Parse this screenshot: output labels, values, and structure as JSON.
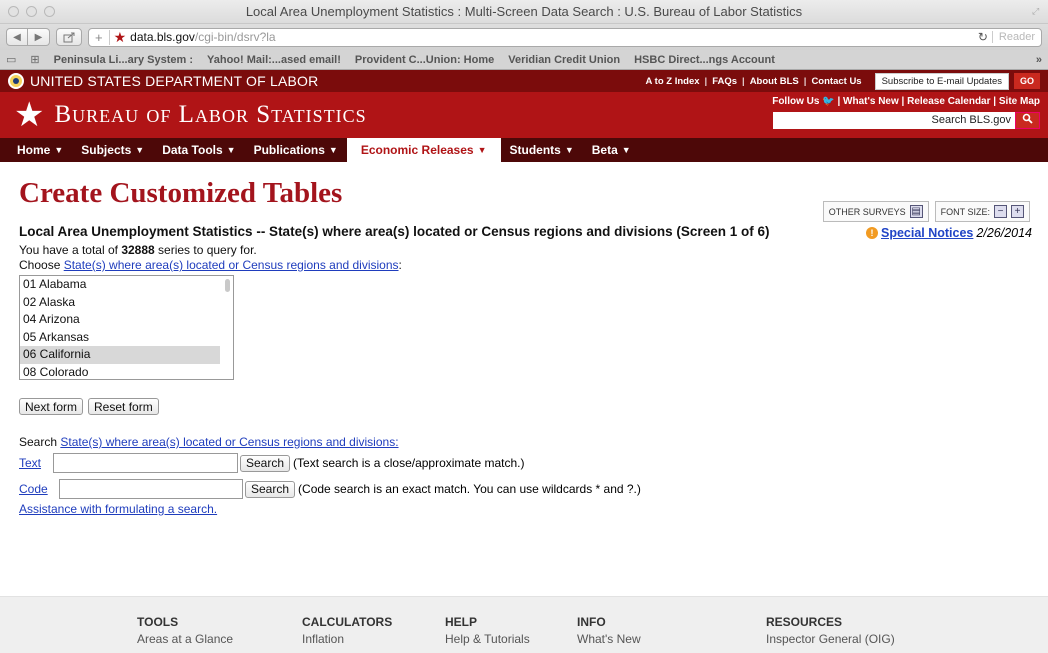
{
  "browser": {
    "window_title": "Local Area Unemployment Statistics : Multi-Screen Data Search : U.S. Bureau of Labor Statistics",
    "url_host": "data.bls.gov",
    "url_path": "/cgi-bin/dsrv?la",
    "reader_label": "Reader",
    "bookmarks": [
      "Peninsula Li...ary System :",
      "Yahoo! Mail:...ased email!",
      "Provident C...Union: Home",
      "Veridian Credit Union",
      "HSBC Direct...ngs Account"
    ],
    "overflow_glyph": "»"
  },
  "dol": {
    "name": "UNITED STATES DEPARTMENT OF LABOR",
    "links": [
      "A to Z Index",
      "FAQs",
      "About BLS",
      "Contact Us"
    ],
    "subscribe": "Subscribe to E-mail Updates",
    "go": "GO"
  },
  "bls": {
    "title": "Bureau of Labor Statistics",
    "follow_us": "Follow Us",
    "follow_links": [
      "What's New",
      "Release Calendar",
      "Site Map"
    ],
    "search_placeholder": "Search BLS.gov",
    "search_btn": "Q"
  },
  "nav": [
    {
      "label": "Home",
      "active": false
    },
    {
      "label": "Subjects",
      "active": false
    },
    {
      "label": "Data Tools",
      "active": false
    },
    {
      "label": "Publications",
      "active": false
    },
    {
      "label": "Economic Releases",
      "active": true
    },
    {
      "label": "Students",
      "active": false
    },
    {
      "label": "Beta",
      "active": false
    }
  ],
  "page": {
    "title": "Create Customized Tables",
    "other_surveys": "OTHER SURVEYS",
    "font_size": "FONT SIZE:",
    "section_title": "Local Area Unemployment Statistics -- State(s) where area(s) located or Census regions and divisions (Screen 1 of 6)",
    "special_notices": "Special Notices",
    "notice_date": "2/26/2014",
    "total_prefix": "You have a total of ",
    "total_count": "32888",
    "total_suffix": " series to query for.",
    "choose_prefix": "Choose ",
    "choose_link": "State(s) where area(s) located or Census regions and divisions",
    "choose_suffix": ":",
    "options": [
      {
        "label": "01 Alabama",
        "selected": false
      },
      {
        "label": "02 Alaska",
        "selected": false
      },
      {
        "label": "04 Arizona",
        "selected": false
      },
      {
        "label": "05 Arkansas",
        "selected": false
      },
      {
        "label": "06 California",
        "selected": true
      },
      {
        "label": "08 Colorado",
        "selected": false
      }
    ],
    "next_form": "Next form",
    "reset_form": "Reset form",
    "search_prefix": "Search ",
    "search_link": "State(s) where area(s) located or Census regions and divisions: ",
    "text_label": "Text",
    "code_label": "Code",
    "search_btn": "Search",
    "text_note": "(Text search is a close/approximate match.)",
    "code_note": "(Code search is an exact match. You can use wildcards * and ?.)",
    "assistance": "Assistance with formulating a search."
  },
  "footer": [
    {
      "head": "TOOLS",
      "item": "Areas at a Glance"
    },
    {
      "head": "CALCULATORS",
      "item": "Inflation"
    },
    {
      "head": "HELP",
      "item": "Help & Tutorials"
    },
    {
      "head": "INFO",
      "item": "What's New"
    },
    {
      "head": "RESOURCES",
      "item": "Inspector General (OIG)"
    }
  ]
}
